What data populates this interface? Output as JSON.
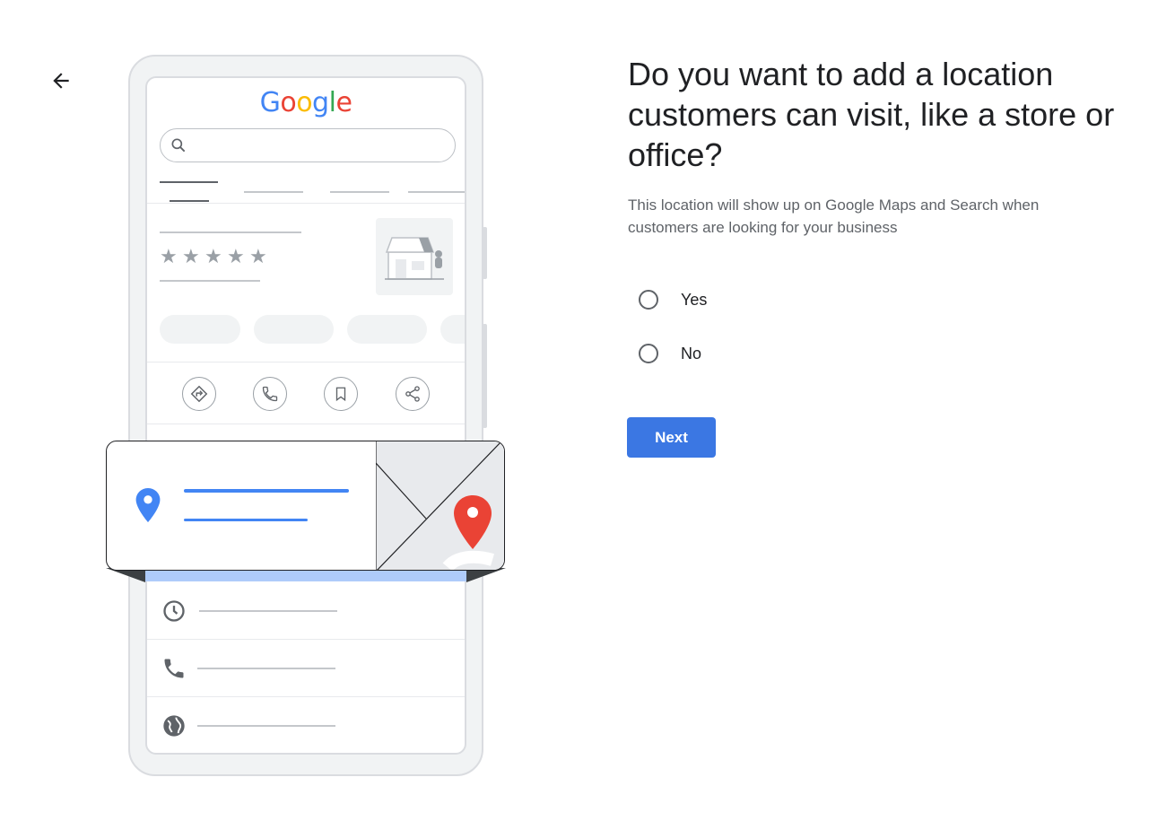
{
  "nav": {
    "back_icon": "arrow-left-icon"
  },
  "illustration": {
    "logo_letters": [
      {
        "char": "G",
        "color": "#4285F4"
      },
      {
        "char": "o",
        "color": "#EA4335"
      },
      {
        "char": "o",
        "color": "#FBBC05"
      },
      {
        "char": "g",
        "color": "#4285F4"
      },
      {
        "char": "l",
        "color": "#34A853"
      },
      {
        "char": "e",
        "color": "#EA4335"
      }
    ],
    "rating_stars": "★",
    "action_icons": [
      "directions-icon",
      "phone-icon",
      "bookmark-icon",
      "share-icon"
    ],
    "info_icons": [
      "clock-icon",
      "phone-icon",
      "globe-icon"
    ],
    "colors": {
      "accent_blue": "#4285F4",
      "pin_red": "#EA4335",
      "strip_blue": "#AECBFA"
    }
  },
  "form": {
    "title": "Do you want to add a location customers can visit, like a store or office?",
    "subtitle": "This location will show up on Google Maps and Search when customers are looking for your business",
    "options": [
      {
        "label": "Yes",
        "selected": false
      },
      {
        "label": "No",
        "selected": false
      }
    ],
    "next_label": "Next"
  },
  "colors": {
    "primary_button": "#3B77E3",
    "text_primary": "#202124",
    "text_secondary": "#5F6368"
  }
}
